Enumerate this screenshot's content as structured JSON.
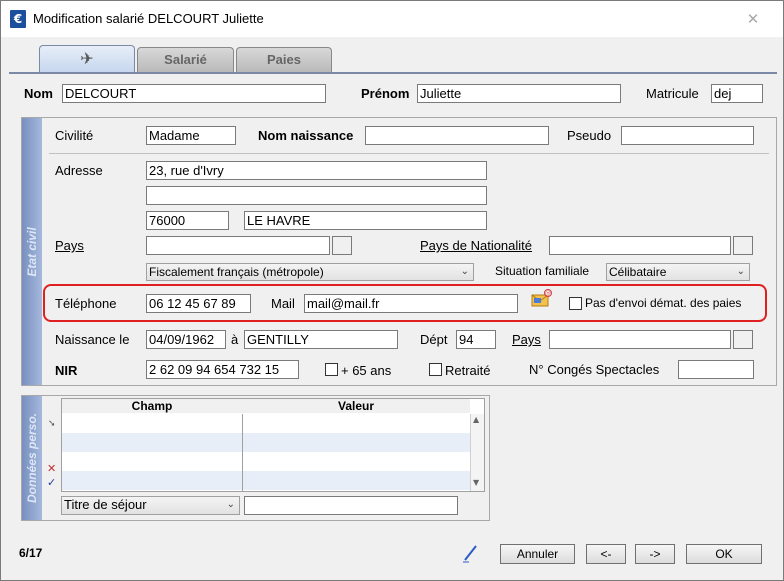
{
  "window": {
    "title": "Modification salarié DELCOURT Juliette",
    "close_glyph": "✕"
  },
  "tabs": [
    {
      "label": "",
      "icon": "tools-icon"
    },
    {
      "label": "Salarié"
    },
    {
      "label": "Paies"
    }
  ],
  "header": {
    "nom_label": "Nom",
    "nom_value": "DELCOURT",
    "prenom_label": "Prénom",
    "prenom_value": "Juliette",
    "matricule_label": "Matricule",
    "matricule_value": "dej"
  },
  "etat_civil": {
    "band_label": "Etat civil",
    "civilite_label": "Civilité",
    "civilite_value": "Madame",
    "nom_naissance_label": "Nom naissance",
    "nom_naissance_value": "",
    "pseudo_label": "Pseudo",
    "pseudo_value": "",
    "adresse_label": "Adresse",
    "adresse_line1": "23, rue d'Ivry",
    "adresse_line2": "",
    "code_postal": "76000",
    "ville": "LE HAVRE",
    "pays_label": "Pays",
    "pays_value": "",
    "pays_nat_label": "Pays de Nationalité",
    "pays_nat_value": "",
    "fiscal_value": "Fiscalement français (métropole)",
    "situation_label": "Situation familiale",
    "situation_value": "Célibataire",
    "telephone_label": "Téléphone",
    "telephone_value": "06 12 45 67 89",
    "mail_label": "Mail",
    "mail_value": "mail@mail.fr",
    "no_dematerialized_label": "Pas d'envoi démat. des paies",
    "naissance_label": "Naissance le",
    "naissance_date": "04/09/1962",
    "a_label": "à",
    "naissance_lieu": "GENTILLY",
    "dept_label": "Dépt",
    "dept_value": "94",
    "pays2_label": "Pays",
    "pays2_value": "",
    "nir_label": "NIR",
    "nir_value": "2 62 09 94 654 732 15",
    "plus65_label": "+ 65 ans",
    "retraite_label": "Retraité",
    "conges_label": "N° Congés Spectacles",
    "conges_value": ""
  },
  "donnees_perso": {
    "band_label": "Données perso.",
    "columns": [
      "Champ",
      "Valeur"
    ],
    "rows": [
      {
        "champ": "",
        "valeur": ""
      },
      {
        "champ": "",
        "valeur": ""
      },
      {
        "champ": "",
        "valeur": ""
      },
      {
        "champ": "",
        "valeur": ""
      }
    ],
    "select_value": "Titre de séjour",
    "value_input": ""
  },
  "footer": {
    "record_counter": "6/17",
    "annuler_label": "Annuler",
    "prev_label": "<-",
    "next_label": "->",
    "ok_label": "OK"
  },
  "colors": {
    "highlight_box": "#e02020",
    "band": "#7890c0",
    "tab_active": "#c6d6ee"
  }
}
